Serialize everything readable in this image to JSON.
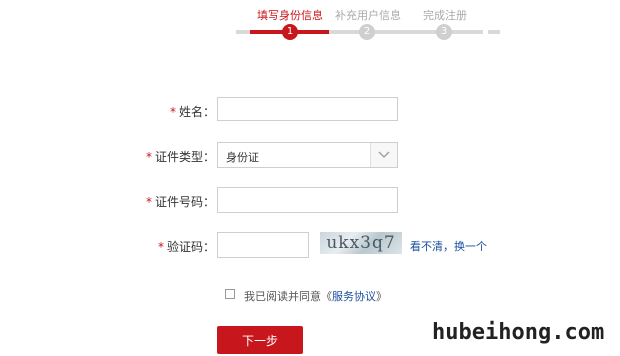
{
  "stepper": {
    "steps": [
      {
        "label": "填写身份信息",
        "number": "1",
        "active": true
      },
      {
        "label": "补充用户信息",
        "number": "2",
        "active": false
      },
      {
        "label": "完成注册",
        "number": "3",
        "active": false
      }
    ]
  },
  "form": {
    "required_mark": "*",
    "name_label": "姓名：",
    "id_type_label": "证件类型：",
    "id_type_value": "身份证",
    "id_number_label": "证件号码：",
    "captcha_label": "验证码：",
    "captcha_text": "ukx3q7",
    "captcha_refresh": "看不清，换一个"
  },
  "agreement": {
    "text": "我已阅读并同意《",
    "link": "服务协议",
    "close": "》"
  },
  "actions": {
    "next_label": "下一步"
  },
  "watermark": "hubeihong.com",
  "colors": {
    "accent": "#c8161d",
    "link": "#1a4fa0"
  }
}
